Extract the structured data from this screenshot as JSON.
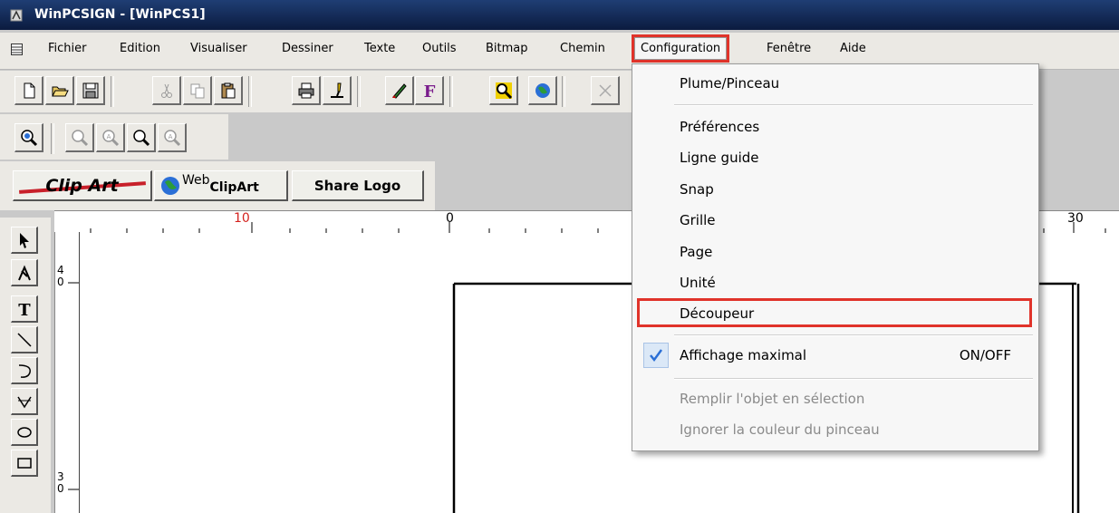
{
  "window": {
    "title": "WinPCSIGN - [WinPCS1]"
  },
  "menubar": {
    "items": [
      "Fichier",
      "Edition",
      "Visualiser",
      "Dessiner",
      "Texte",
      "Outils",
      "Bitmap",
      "Chemin",
      "Configuration",
      "Fenêtre",
      "Aide"
    ],
    "active": "Configuration"
  },
  "toolbar": {
    "clipart_label": "Clip Art",
    "webclipart_web": "Web",
    "webclipart_clip": "ClipArt",
    "sharelogo_label": "Share Logo"
  },
  "rulers": {
    "h_labels": [
      "10",
      "0",
      "30"
    ],
    "v_labels": [
      "4",
      "0",
      "3",
      "0"
    ]
  },
  "config_menu": {
    "items": [
      {
        "label": "Plume/Pinceau",
        "enabled": true
      },
      {
        "label": "Préférences",
        "enabled": true
      },
      {
        "label": "Ligne guide",
        "enabled": true
      },
      {
        "label": "Snap",
        "enabled": true
      },
      {
        "label": "Grille",
        "enabled": true
      },
      {
        "label": "Page",
        "enabled": true
      },
      {
        "label": "Unité",
        "enabled": true
      },
      {
        "label": "Découpeur",
        "enabled": true,
        "highlighted": true
      },
      {
        "label": "Affichage maximal",
        "shortcut": "ON/OFF",
        "checked": true,
        "enabled": true
      },
      {
        "label": "Remplir l'objet en sélection",
        "enabled": false
      },
      {
        "label": "Ignorer la couleur du pinceau",
        "enabled": false
      }
    ]
  },
  "colors": {
    "highlight_red": "#e0332a",
    "titlebar": "#0b1b3f",
    "check_blue": "#2a6fd6"
  }
}
